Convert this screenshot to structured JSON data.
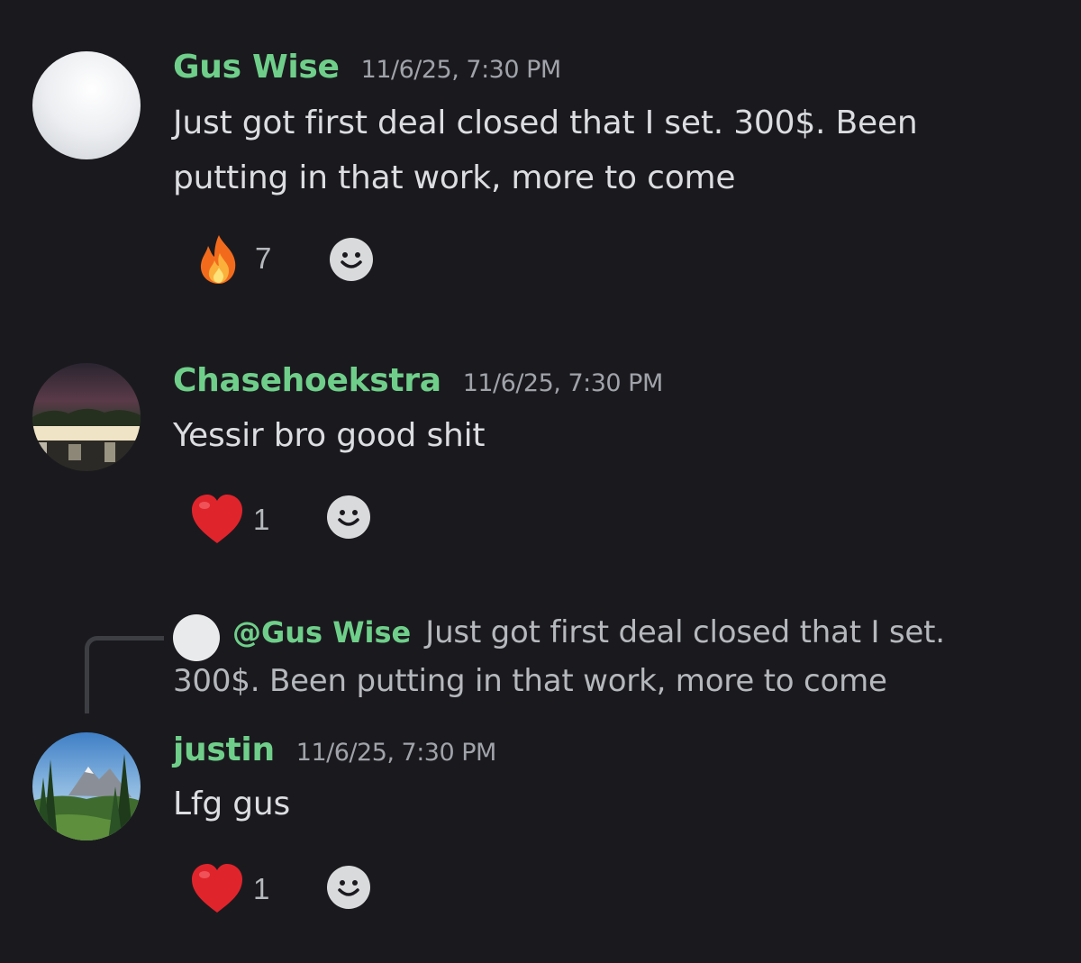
{
  "colors": {
    "background": "#1a1a1e",
    "username": "#6fcf8a",
    "timestamp": "#a0a3aa",
    "message_text": "#dcdde0"
  },
  "messages": [
    {
      "author": "Gus Wise",
      "timestamp": "11/6/25, 7:30 PM",
      "lines": [
        "Just got first deal closed that I set. 300$. Been",
        "putting in that work, more to come"
      ],
      "reaction": {
        "emoji": "fire-emoji",
        "count": "7"
      }
    },
    {
      "author": "Chasehoekstra",
      "timestamp": "11/6/25, 7:30 PM",
      "lines": [
        "Yessir bro good shit"
      ],
      "reaction": {
        "emoji": "heart-emoji",
        "count": "1"
      }
    },
    {
      "reply_to": {
        "mention": "@Gus Wise",
        "line1": "Just got first deal closed that I set.",
        "line2": "300$. Been putting in that work, more to come"
      },
      "author": "justin",
      "timestamp": "11/6/25, 7:30 PM",
      "lines": [
        "Lfg gus"
      ],
      "reaction": {
        "emoji": "heart-emoji",
        "count": "1"
      }
    }
  ],
  "icons": {
    "add_reaction": "smile-icon"
  }
}
